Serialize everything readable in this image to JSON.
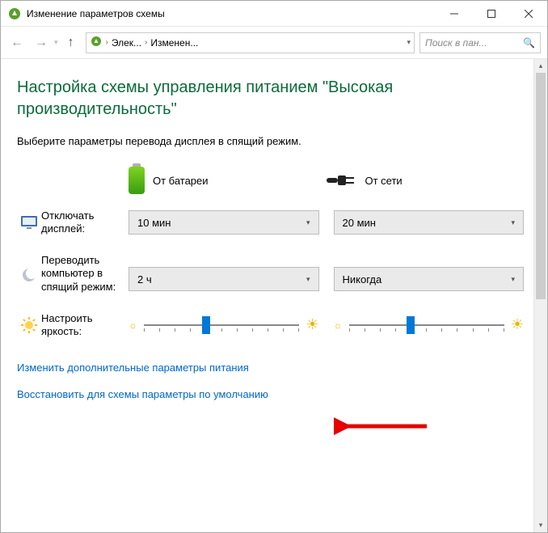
{
  "window": {
    "title": "Изменение параметров схемы",
    "minimize": "—",
    "maximize": "▢",
    "close": "✕"
  },
  "toolbar": {
    "breadcrumb1": "Элек...",
    "breadcrumb2": "Изменен...",
    "search_placeholder": "Поиск в пан..."
  },
  "heading": "Настройка схемы управления питанием \"Высокая производительность\"",
  "subtitle": "Выберите параметры перевода дисплея в спящий режим.",
  "columns": {
    "battery": "От батареи",
    "plugged": "От сети"
  },
  "rows": {
    "display_off": {
      "label": "Отключать дисплей:",
      "battery_value": "10 мин",
      "plugged_value": "20 мин"
    },
    "sleep": {
      "label": "Переводить компьютер в спящий режим:",
      "battery_value": "2 ч",
      "plugged_value": "Никогда"
    },
    "brightness": {
      "label": "Настроить яркость:"
    }
  },
  "slider": {
    "battery_percent": 40,
    "plugged_percent": 40
  },
  "links": {
    "advanced": "Изменить дополнительные параметры питания",
    "restore": "Восстановить для схемы параметры по умолчанию"
  }
}
